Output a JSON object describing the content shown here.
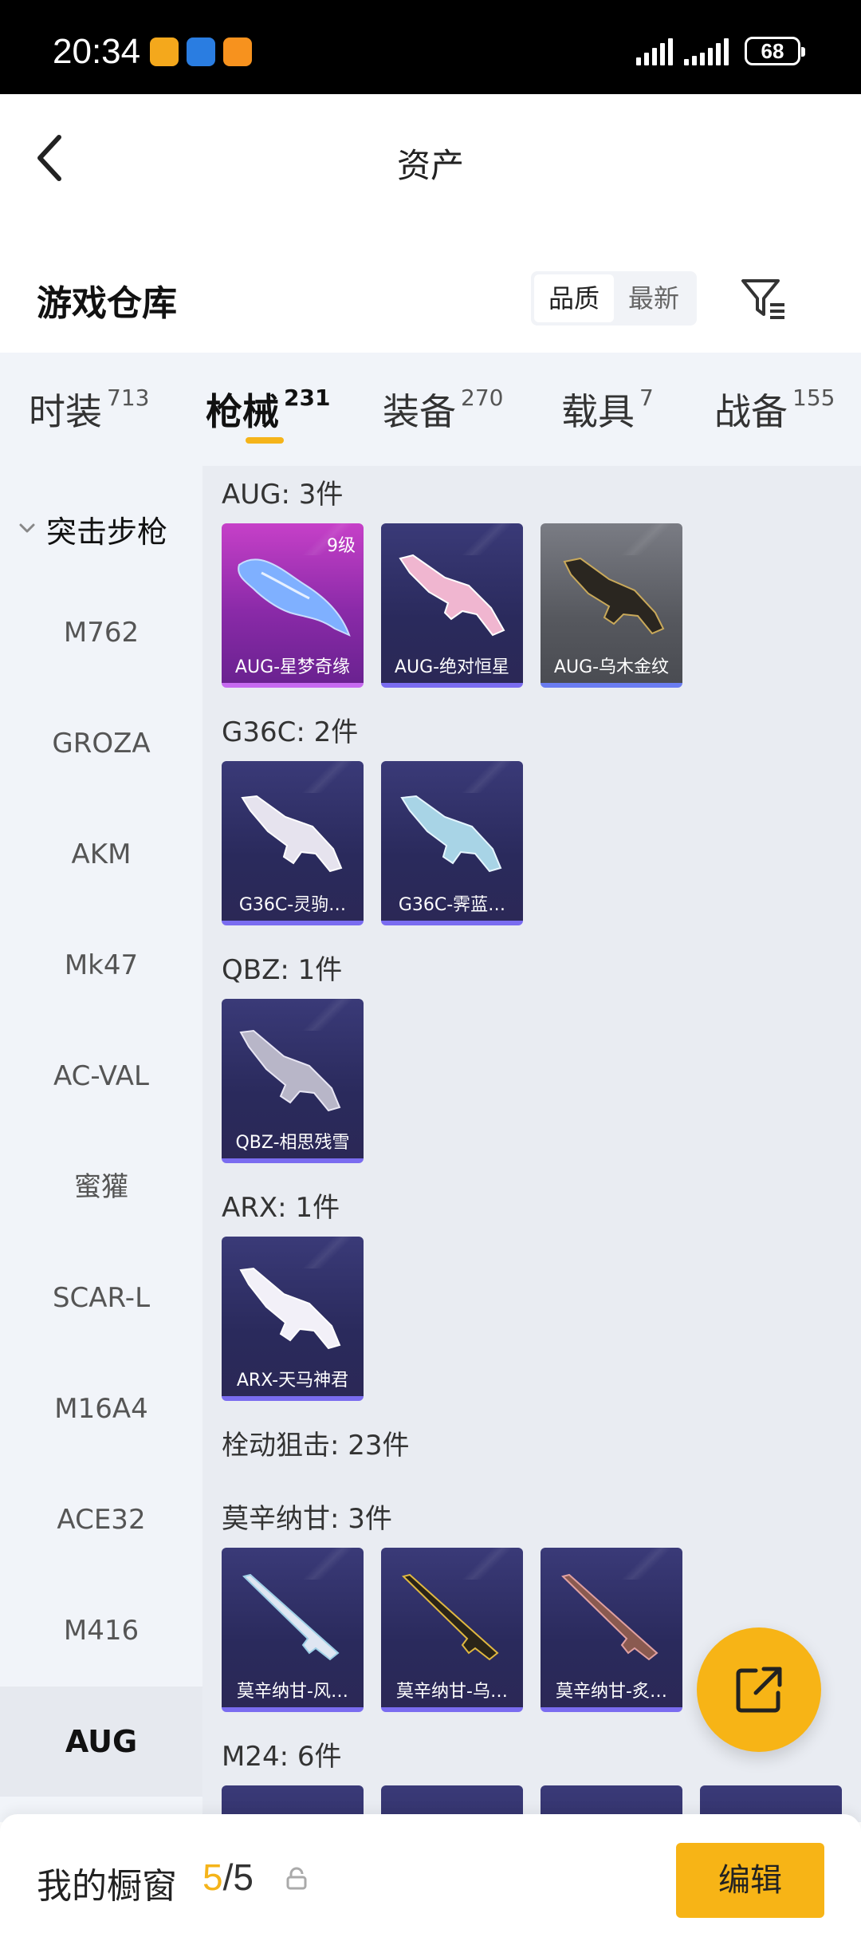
{
  "status_bar": {
    "time": "20:34",
    "battery": "68"
  },
  "nav": {
    "title": "资产"
  },
  "warehouse": {
    "title": "游戏仓库",
    "sort_options": [
      "品质",
      "最新"
    ]
  },
  "tabs": [
    {
      "label": "时装",
      "count": "713"
    },
    {
      "label": "枪械",
      "count": "231"
    },
    {
      "label": "装备",
      "count": "270"
    },
    {
      "label": "载具",
      "count": "7"
    },
    {
      "label": "战备",
      "count": "155"
    }
  ],
  "sidebar": {
    "group": "突击步枪",
    "items": [
      "M762",
      "GROZA",
      "AKM",
      "Mk47",
      "AC-VAL",
      "蜜獾",
      "SCAR-L",
      "M16A4",
      "ACE32",
      "M416",
      "AUG"
    ],
    "active": "AUG"
  },
  "sections": [
    {
      "title": "AUG: 3件",
      "items": [
        {
          "name": "AUG-星梦奇缘",
          "level": "9级",
          "rarity": "purple"
        },
        {
          "name": "AUG-绝对恒星",
          "rarity": "blue"
        },
        {
          "name": "AUG-乌木金纹",
          "rarity": "grey"
        }
      ]
    },
    {
      "title": "G36C: 2件",
      "items": [
        {
          "name": "G36C-灵驹…",
          "rarity": "blue"
        },
        {
          "name": "G36C-霁蓝…",
          "rarity": "blue"
        }
      ]
    },
    {
      "title": "QBZ: 1件",
      "items": [
        {
          "name": "QBZ-相思残雪",
          "rarity": "blue"
        }
      ]
    },
    {
      "title": "ARX: 1件",
      "items": [
        {
          "name": "ARX-天马神君",
          "rarity": "blue"
        }
      ]
    },
    {
      "title": "栓动狙击: 23件",
      "items": []
    },
    {
      "title": "莫辛纳甘: 3件",
      "items": [
        {
          "name": "莫辛纳甘-风…",
          "rarity": "blue"
        },
        {
          "name": "莫辛纳甘-乌…",
          "rarity": "blue"
        },
        {
          "name": "莫辛纳甘-炙…",
          "rarity": "blue"
        }
      ]
    },
    {
      "title": "M24: 6件",
      "items": []
    }
  ],
  "bottom_bar": {
    "label": "我的橱窗",
    "current": "5",
    "separator": "/",
    "total": "5",
    "edit_label": "编辑"
  },
  "colors": {
    "accent": "#f7b416",
    "card_blue": "#2a2a5c",
    "card_purple": "#c640c8",
    "card_grey": "#56585e"
  }
}
